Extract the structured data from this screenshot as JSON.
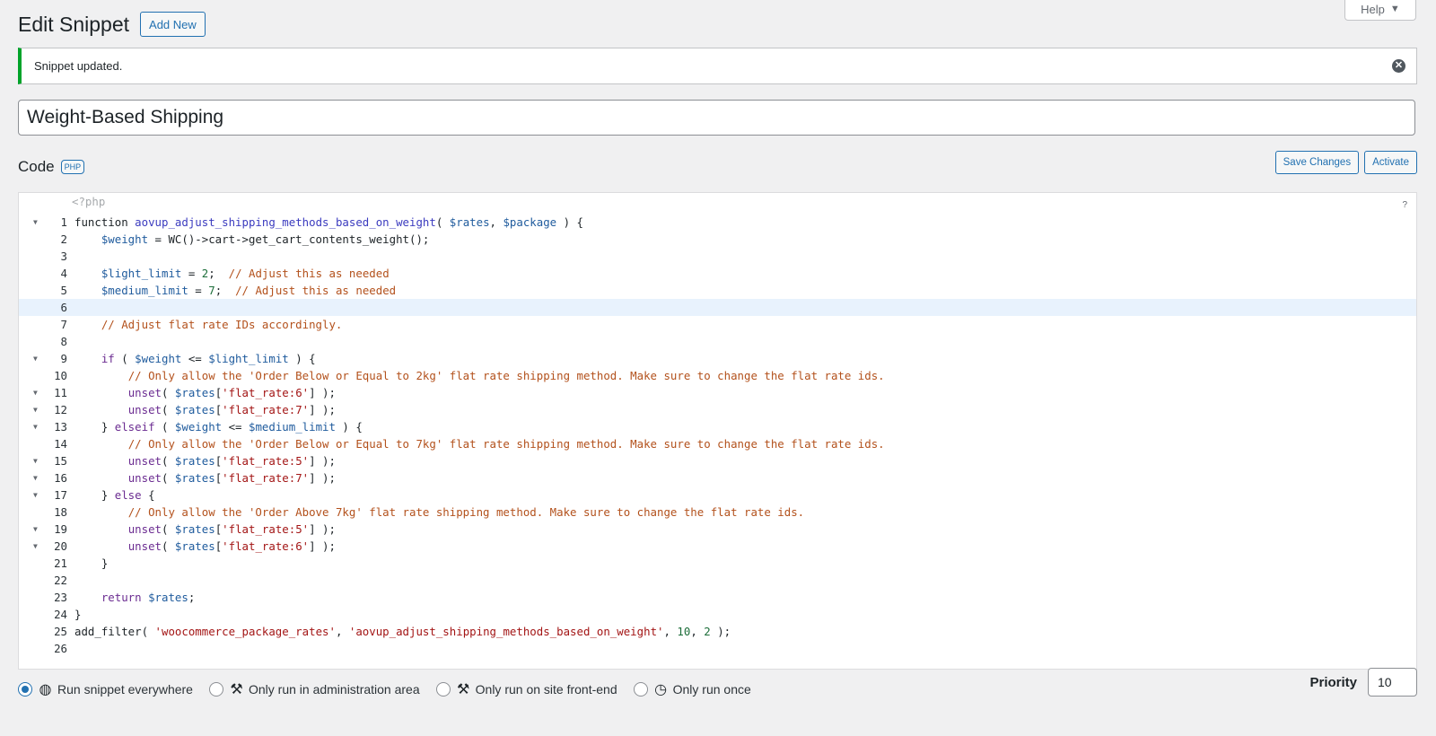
{
  "help_tab": {
    "label": "Help"
  },
  "header": {
    "title": "Edit Snippet",
    "add_new_label": "Add New"
  },
  "notice": {
    "message": "Snippet updated."
  },
  "snippet": {
    "name": "Weight-Based Shipping"
  },
  "code_section": {
    "label": "Code",
    "language": "PHP"
  },
  "actions": {
    "save_label": "Save Changes",
    "activate_label": "Activate"
  },
  "editor": {
    "php_open_tag": "<?php",
    "help_glyph": "?",
    "active_line": 6,
    "lines": [
      {
        "n": "1",
        "text": "function aovup_adjust_shipping_methods_based_on_weight( $rates, $package ) {",
        "fold": true
      },
      {
        "n": "2",
        "text": "    $weight = WC()->cart->get_cart_contents_weight();",
        "fold": false
      },
      {
        "n": "3",
        "text": "",
        "fold": false
      },
      {
        "n": "4",
        "text": "    $light_limit = 2;  // Adjust this as needed",
        "fold": false
      },
      {
        "n": "5",
        "text": "    $medium_limit = 7;  // Adjust this as needed",
        "fold": false
      },
      {
        "n": "6",
        "text": "",
        "fold": false
      },
      {
        "n": "7",
        "text": "    // Adjust flat rate IDs accordingly.",
        "fold": false
      },
      {
        "n": "8",
        "text": "",
        "fold": false
      },
      {
        "n": "9",
        "text": "    if ( $weight <= $light_limit ) {",
        "fold": true
      },
      {
        "n": "10",
        "text": "        // Only allow the 'Order Below or Equal to 2kg' flat rate shipping method. Make sure to change the flat rate ids.",
        "fold": false
      },
      {
        "n": "11",
        "text": "        unset( $rates['flat_rate:6'] );",
        "fold": true
      },
      {
        "n": "12",
        "text": "        unset( $rates['flat_rate:7'] );",
        "fold": true
      },
      {
        "n": "13",
        "text": "    } elseif ( $weight <= $medium_limit ) {",
        "fold": true
      },
      {
        "n": "14",
        "text": "        // Only allow the 'Order Below or Equal to 7kg' flat rate shipping method. Make sure to change the flat rate ids.",
        "fold": false
      },
      {
        "n": "15",
        "text": "        unset( $rates['flat_rate:5'] );",
        "fold": true
      },
      {
        "n": "16",
        "text": "        unset( $rates['flat_rate:7'] );",
        "fold": true
      },
      {
        "n": "17",
        "text": "    } else {",
        "fold": true
      },
      {
        "n": "18",
        "text": "        // Only allow the 'Order Above 7kg' flat rate shipping method. Make sure to change the flat rate ids.",
        "fold": false
      },
      {
        "n": "19",
        "text": "        unset( $rates['flat_rate:5'] );",
        "fold": true
      },
      {
        "n": "20",
        "text": "        unset( $rates['flat_rate:6'] );",
        "fold": true
      },
      {
        "n": "21",
        "text": "    }",
        "fold": false
      },
      {
        "n": "22",
        "text": "",
        "fold": false
      },
      {
        "n": "23",
        "text": "    return $rates;",
        "fold": false
      },
      {
        "n": "24",
        "text": "}",
        "fold": false
      },
      {
        "n": "25",
        "text": "add_filter( 'woocommerce_package_rates', 'aovup_adjust_shipping_methods_based_on_weight', 10, 2 );",
        "fold": false
      },
      {
        "n": "26",
        "text": "",
        "fold": false
      }
    ]
  },
  "run_options": [
    {
      "label": "Run snippet everywhere",
      "icon": "globe-icon",
      "checked": true
    },
    {
      "label": "Only run in administration area",
      "icon": "wrench-icon",
      "checked": false
    },
    {
      "label": "Only run on site front-end",
      "icon": "hammer-icon",
      "checked": false
    },
    {
      "label": "Only run once",
      "icon": "clock-icon",
      "checked": false
    }
  ],
  "priority": {
    "label": "Priority",
    "value": "10"
  },
  "colors": {
    "accent": "#2271b1",
    "success": "#00a32a",
    "active_line": "#e8f2fd"
  }
}
